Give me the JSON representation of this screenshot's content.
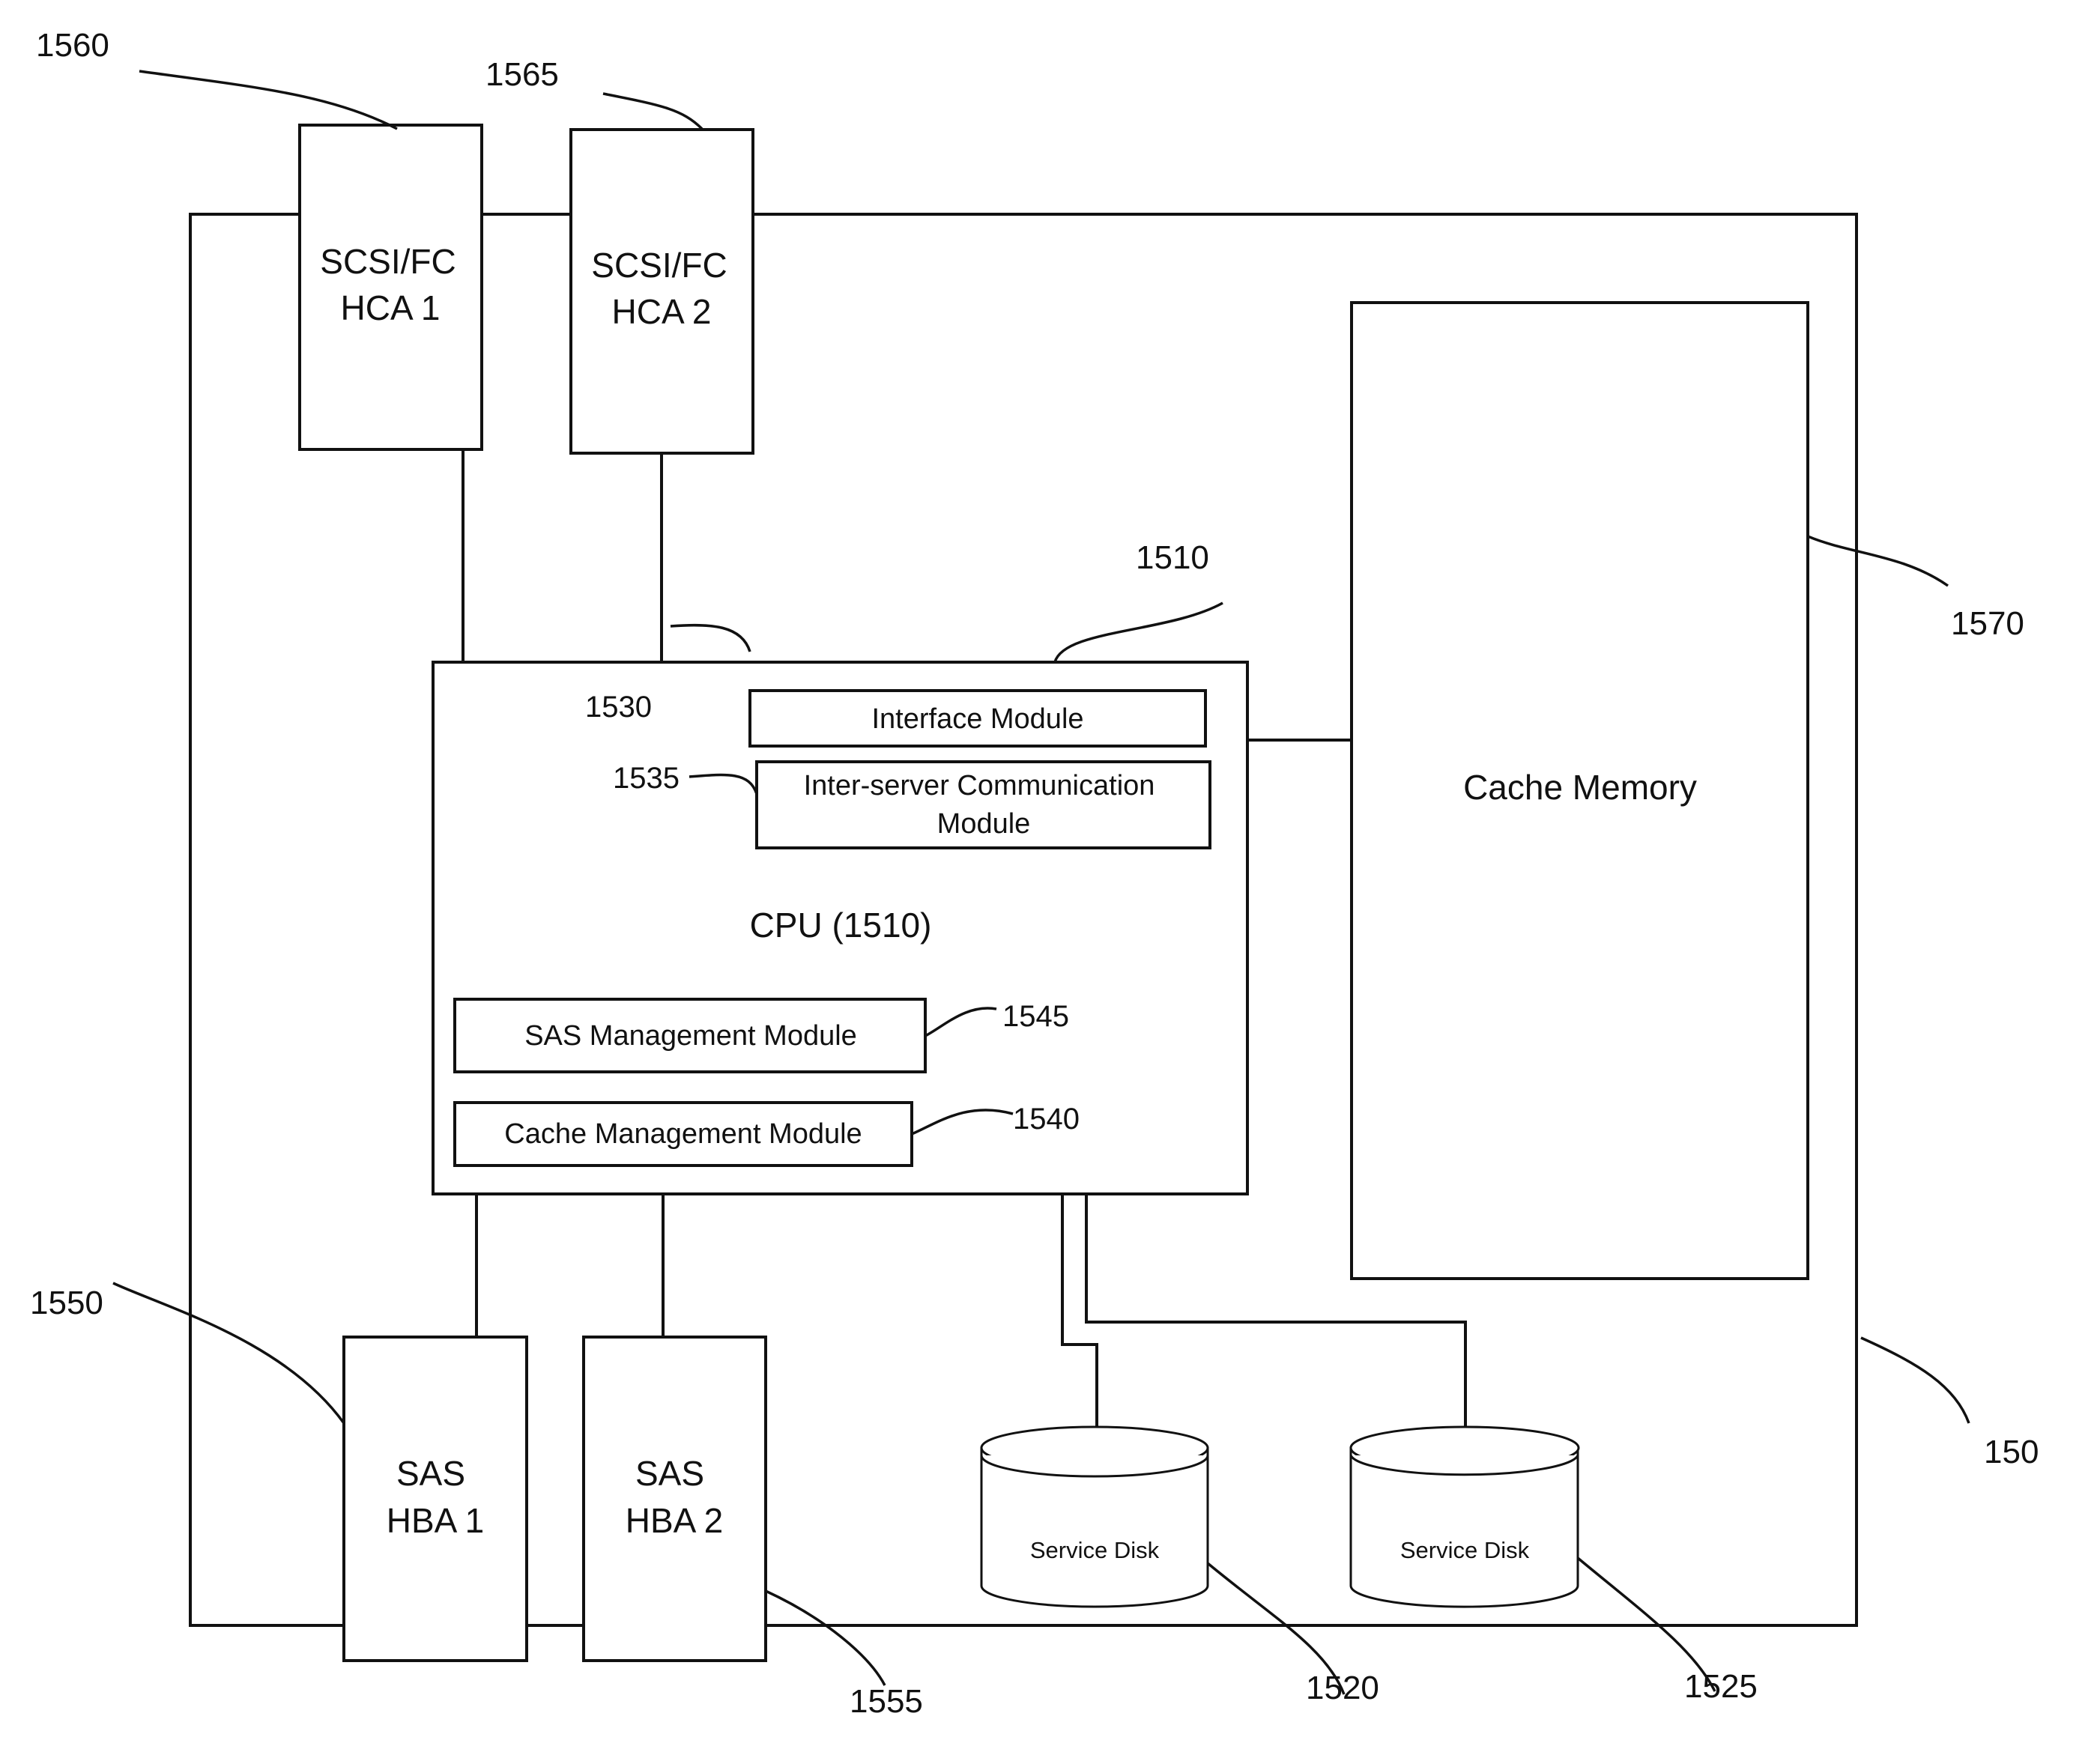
{
  "diagram": {
    "container": {
      "ref": "150"
    },
    "hca": [
      {
        "ref": "1560",
        "line1": "SCSI/FC",
        "line2": "HCA 1"
      },
      {
        "ref": "1565",
        "line1": "SCSI/FC",
        "line2": "HCA 2"
      }
    ],
    "cpu": {
      "ref": "1510",
      "title": "CPU (1510)",
      "modules": [
        {
          "ref": "1530",
          "label": "Interface Module"
        },
        {
          "ref": "1535",
          "line1": "Inter-server Communication",
          "line2": "Module"
        },
        {
          "ref": "1545",
          "label": "SAS Management Module"
        },
        {
          "ref": "1540",
          "label": "Cache Management Module"
        }
      ]
    },
    "cache_memory": {
      "ref": "1570",
      "label": "Cache Memory"
    },
    "hba": [
      {
        "ref": "1550",
        "line1": "SAS",
        "line2": "HBA 1"
      },
      {
        "ref": "1555",
        "line1": "SAS",
        "line2": "HBA 2"
      }
    ],
    "disks": [
      {
        "ref": "1520",
        "label": "Service Disk"
      },
      {
        "ref": "1525",
        "label": "Service Disk"
      }
    ]
  }
}
